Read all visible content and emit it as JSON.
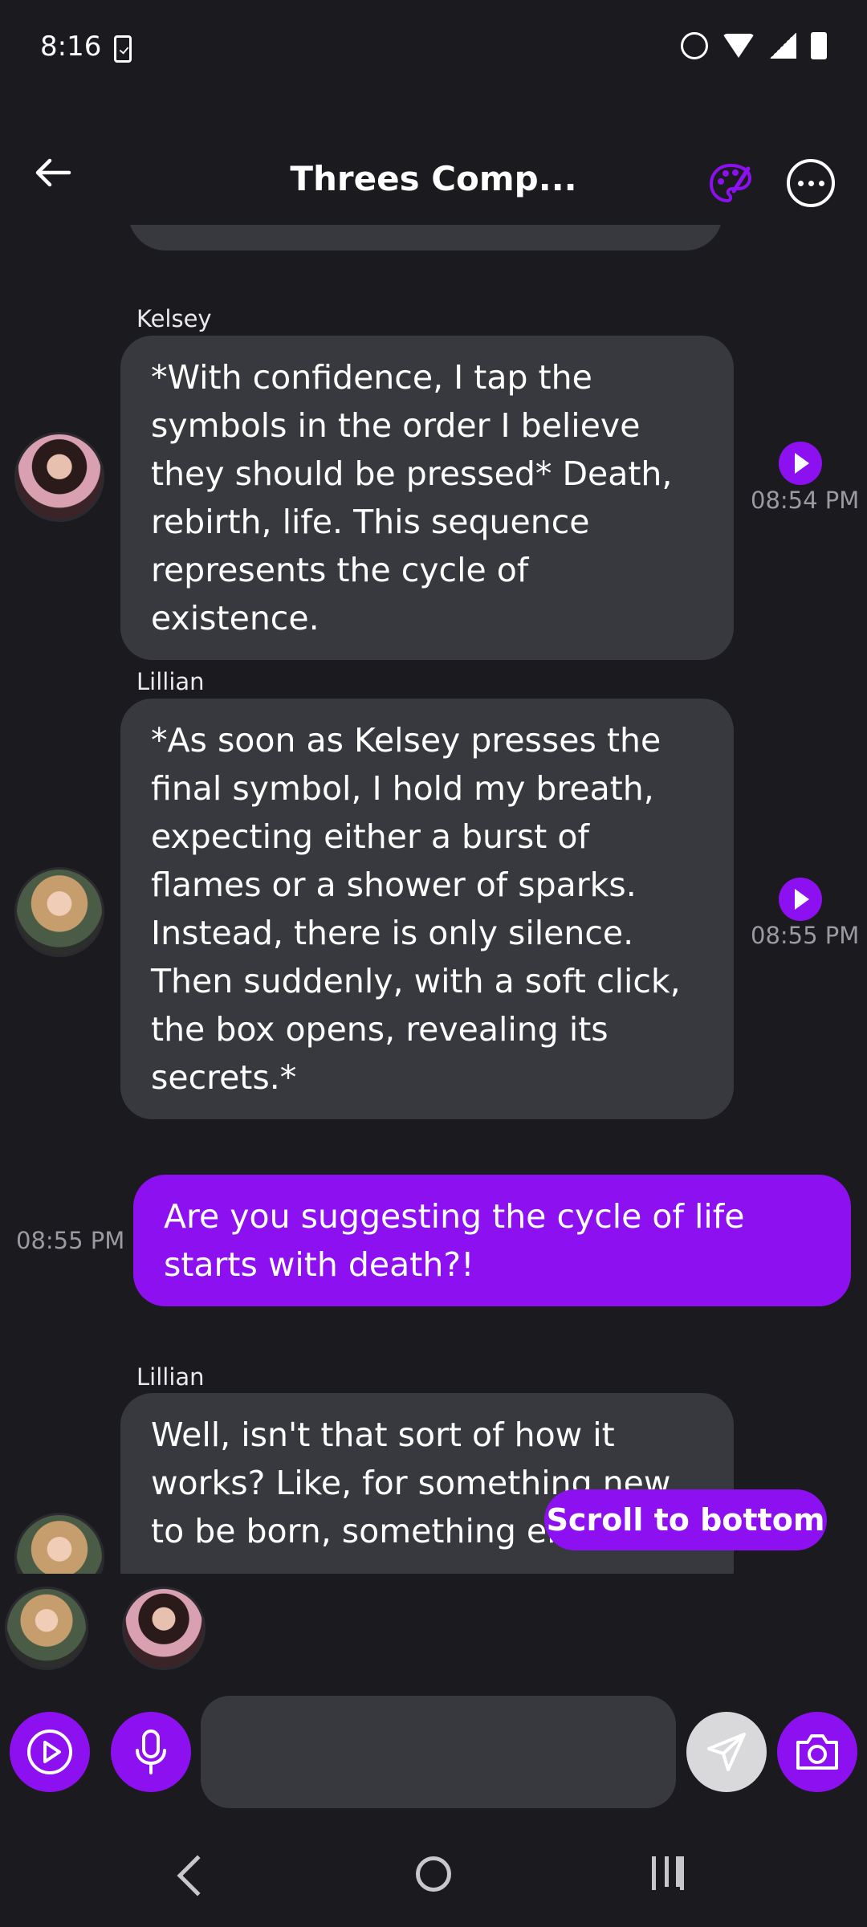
{
  "status_bar": {
    "time": "8:16"
  },
  "header": {
    "title": "Threes Comp..."
  },
  "messages": [
    {
      "sender": "Kelsey",
      "lines": [
        "*With confidence, I tap the",
        "symbols in the order I believe",
        "they should be pressed* Death,",
        "rebirth, life. This sequence",
        "represents the cycle of existence."
      ],
      "time": "08:54 PM"
    },
    {
      "sender": "Lillian",
      "lines": [
        "*As soon as Kelsey presses the",
        "final symbol, I hold my breath,",
        "expecting either a burst of",
        "flames or a shower of sparks.",
        "Instead, there is only silence.",
        "Then suddenly, with a soft click,",
        "the box opens, revealing its",
        "secrets.*"
      ],
      "time": "08:55 PM"
    },
    {
      "sender": "",
      "lines": [
        "Are you suggesting the cycle of life",
        "starts with death?!"
      ],
      "time": "08:55 PM"
    },
    {
      "sender": "Lillian",
      "lines": [
        "Well, isn't that sort of how it",
        "works? Like, for something new",
        "to be born, something else"
      ]
    }
  ],
  "scroll_button": {
    "label": "Scroll to bottom"
  },
  "input": {
    "placeholder": ""
  },
  "colors": {
    "accent": "#8c10f0",
    "bubble": "#38393f",
    "background": "#1b1b1f"
  }
}
